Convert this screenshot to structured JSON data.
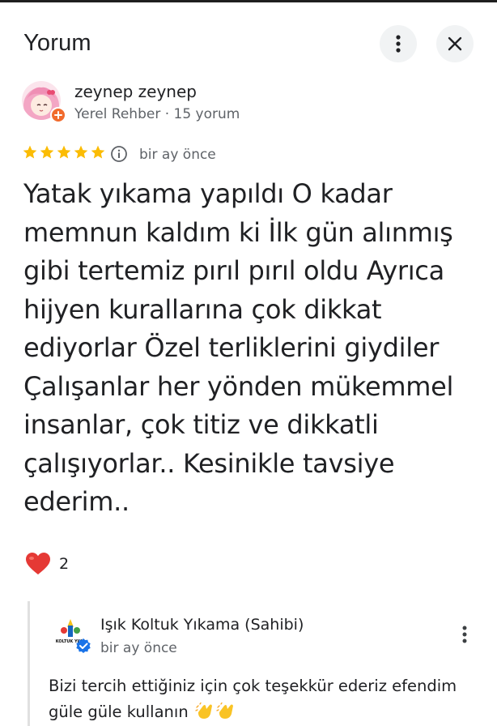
{
  "header": {
    "title": "Yorum",
    "more_icon": "more-vert-icon",
    "close_icon": "close-icon"
  },
  "review": {
    "author_name": "zeynep zeynep",
    "author_meta": "Yerel Rehber · 15 yorum",
    "rating": 5,
    "rating_max": 5,
    "time": "bir ay önce",
    "text": "Yatak yıkama yapıldı O kadar memnun kaldım ki İlk gün alınmış gibi tertemiz pırıl pırıl oldu Ayrıca hijyen kurallarına çok dikkat ediyorlar Özel terliklerini giydiler Çalışanlar her yönden mükemmel insanlar, çok titiz ve dikkatli çalışıyorlar.. Kesinikle tavsiye ederim..",
    "likes": "2"
  },
  "owner_response": {
    "name": "Işık Koltuk Yıkama (Sahibi)",
    "time": "bir ay önce",
    "logo_text": "KOLTUK YIKA",
    "text": "Bizi tercih ettiğiniz için çok teşekkür ederiz efendim güle güle kullanın"
  },
  "colors": {
    "star": "#fbbc04",
    "heart": "#e53935",
    "guide_badge": "#f16b2d",
    "verified": "#1a73e8",
    "secondary_text": "#5f6368"
  }
}
